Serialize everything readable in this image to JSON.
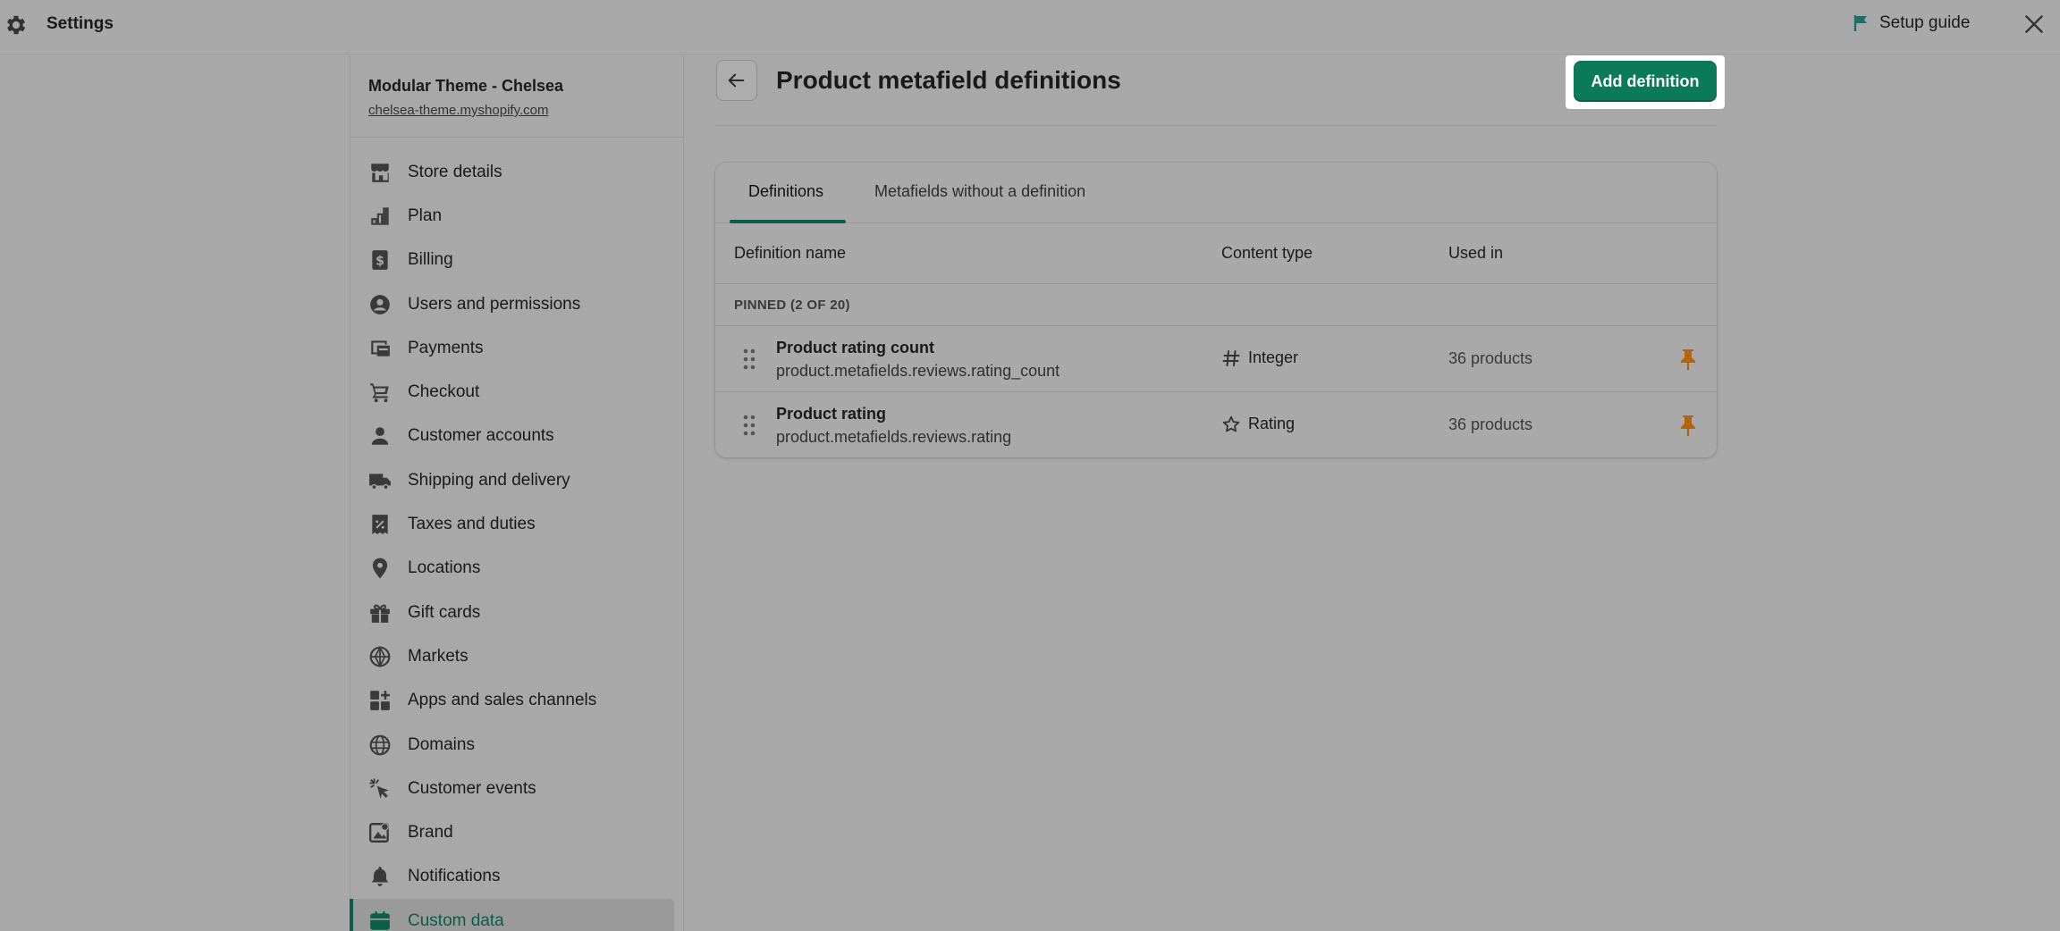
{
  "topbar": {
    "title": "Settings",
    "setup_guide": "Setup guide",
    "icons": {
      "settings": "gear-icon",
      "setup": "flag-icon",
      "close": "close-icon"
    }
  },
  "store": {
    "name": "Modular Theme - Chelsea",
    "url": "chelsea-theme.myshopify.com"
  },
  "sidebar": {
    "items": [
      {
        "label": "Store details",
        "icon": "store-icon"
      },
      {
        "label": "Plan",
        "icon": "plan-icon"
      },
      {
        "label": "Billing",
        "icon": "billing-icon"
      },
      {
        "label": "Users and permissions",
        "icon": "user-circle-icon"
      },
      {
        "label": "Payments",
        "icon": "payments-icon"
      },
      {
        "label": "Checkout",
        "icon": "cart-icon"
      },
      {
        "label": "Customer accounts",
        "icon": "person-icon"
      },
      {
        "label": "Shipping and delivery",
        "icon": "truck-icon"
      },
      {
        "label": "Taxes and duties",
        "icon": "receipt-icon"
      },
      {
        "label": "Locations",
        "icon": "location-icon"
      },
      {
        "label": "Gift cards",
        "icon": "gift-icon"
      },
      {
        "label": "Markets",
        "icon": "globe-icon"
      },
      {
        "label": "Apps and sales channels",
        "icon": "apps-icon"
      },
      {
        "label": "Domains",
        "icon": "domains-icon"
      },
      {
        "label": "Customer events",
        "icon": "cursor-click-icon"
      },
      {
        "label": "Brand",
        "icon": "brand-icon"
      },
      {
        "label": "Notifications",
        "icon": "bell-icon"
      },
      {
        "label": "Custom data",
        "icon": "custom-data-icon",
        "active": true
      }
    ]
  },
  "main": {
    "title": "Product metafield definitions",
    "add_button": "Add definition",
    "tabs": [
      "Definitions",
      "Metafields without a definition"
    ],
    "columns": [
      "Definition name",
      "Content type",
      "Used in"
    ],
    "section_label": "PINNED (2 OF 20)",
    "rows": [
      {
        "name": "Product rating count",
        "key": "product.metafields.reviews.rating_count",
        "type": "Integer",
        "type_icon": "hash-icon",
        "used": "36 products"
      },
      {
        "name": "Product rating",
        "key": "product.metafields.reviews.rating",
        "type": "Rating",
        "type_icon": "star-icon",
        "used": "36 products"
      }
    ]
  },
  "colors": {
    "accent": "#0a7a57",
    "pin": "#b3630c",
    "active_nav": "#0b5e46"
  }
}
